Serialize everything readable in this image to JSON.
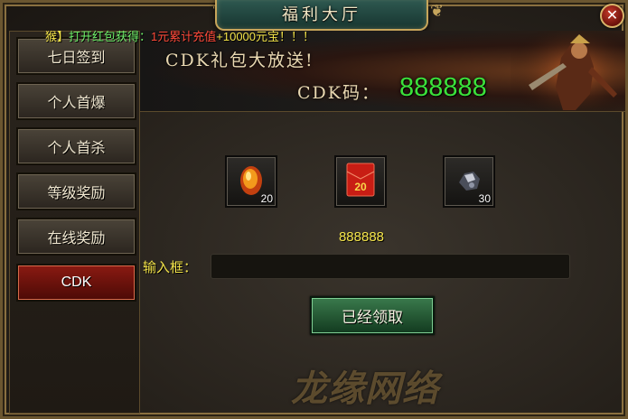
{
  "window": {
    "title": "福利大厅",
    "close_icon": "close-x-icon"
  },
  "marquee": {
    "source": "猴】",
    "action": "打开红包获得：",
    "reward_a": "1元累计充值",
    "reward_b": "+10000元宝！！！"
  },
  "sidebar": {
    "items": [
      {
        "label": "七日签到",
        "active": false
      },
      {
        "label": "个人首爆",
        "active": false
      },
      {
        "label": "个人首杀",
        "active": false
      },
      {
        "label": "等级奖励",
        "active": false
      },
      {
        "label": "在线奖励",
        "active": false
      },
      {
        "label": "CDK",
        "active": true
      }
    ]
  },
  "banner": {
    "headline": "CDK礼包大放送!",
    "code_label": "CDK码：",
    "code_value": "888888"
  },
  "rewards": [
    {
      "icon": "fire-gem-icon",
      "count": "20"
    },
    {
      "icon": "red-envelope-icon",
      "count": "",
      "badge": "20"
    },
    {
      "icon": "silver-ore-icon",
      "count": "30"
    }
  ],
  "code_display": "888888",
  "input": {
    "label": "输入框：",
    "value": "",
    "placeholder": ""
  },
  "claim_button": {
    "label": "已经领取"
  },
  "watermark": "龙缘网络",
  "colors": {
    "accent_green": "#3be03a",
    "highlight_yellow": "#f4e44a",
    "active_red": "#8a1a12"
  }
}
